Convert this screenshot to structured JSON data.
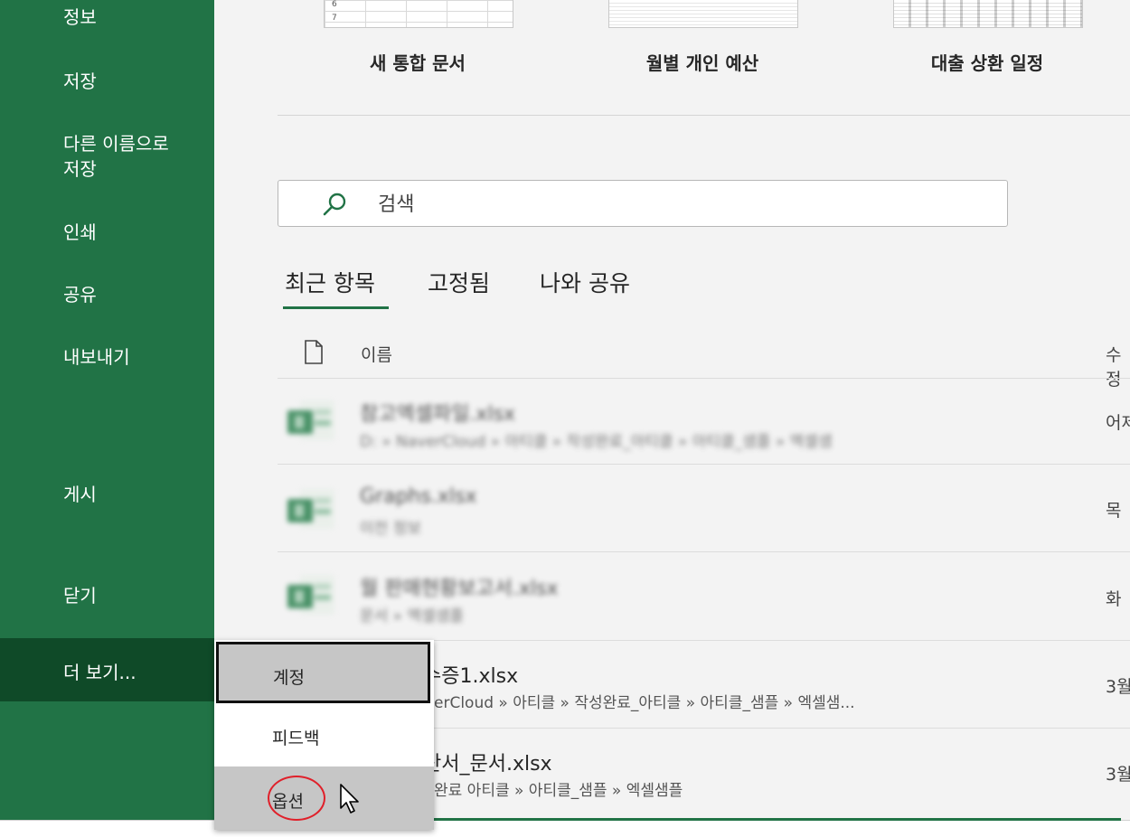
{
  "sidebar": {
    "items": [
      {
        "label": "정보"
      },
      {
        "label": "저장"
      },
      {
        "label": "다른 이름으로"
      },
      {
        "label": "저장"
      },
      {
        "label": "인쇄"
      },
      {
        "label": "공유"
      },
      {
        "label": "내보내기"
      },
      {
        "label": "게시"
      },
      {
        "label": "닫기"
      }
    ],
    "more_label": "더 보기..."
  },
  "templates": [
    {
      "label": "새 통합 문서",
      "row_numbers": [
        "6",
        "7"
      ]
    },
    {
      "label": "월별 개인 예산"
    },
    {
      "label": "대출 상환 일정"
    }
  ],
  "search": {
    "placeholder": "검색"
  },
  "tabs": [
    {
      "label": "최근 항목",
      "active": true
    },
    {
      "label": "고정됨"
    },
    {
      "label": "나와 공유"
    }
  ],
  "list": {
    "header_name": "이름",
    "header_modified": "수정",
    "files": [
      {
        "name": "참고엑셀파일.xlsx",
        "path": "D: » NaverCloud » 아티클 » 작성완료_아티클 » 아티클_샘플 » 엑셀샘",
        "date": "어제",
        "blurred": true
      },
      {
        "name": "Graphs.xlsx",
        "path": "이전 정보",
        "date": "목",
        "blurred": true
      },
      {
        "name": "월 판매현황보고서.xlsx",
        "path": "문서 » 엑셀샘플",
        "date": "화",
        "blurred": true
      },
      {
        "name": "수증1.xlsx",
        "path": "erCloud » 아티클 » 작성완료_아티클 » 아티클_샘플 » 엑셀샘...",
        "date": "3월"
      },
      {
        "name": "산서_문서.xlsx",
        "path": "완료 아티클 » 아티클_샘플 » 엑셀샘플",
        "date": "3월"
      }
    ]
  },
  "popup": {
    "account": "계정",
    "feedback": "피드백",
    "options": "옵션"
  },
  "colors": {
    "sidebar": "#217346",
    "sidebar_selected": "#0f4a28",
    "accent": "#217346",
    "annotation": "#e0202a"
  }
}
